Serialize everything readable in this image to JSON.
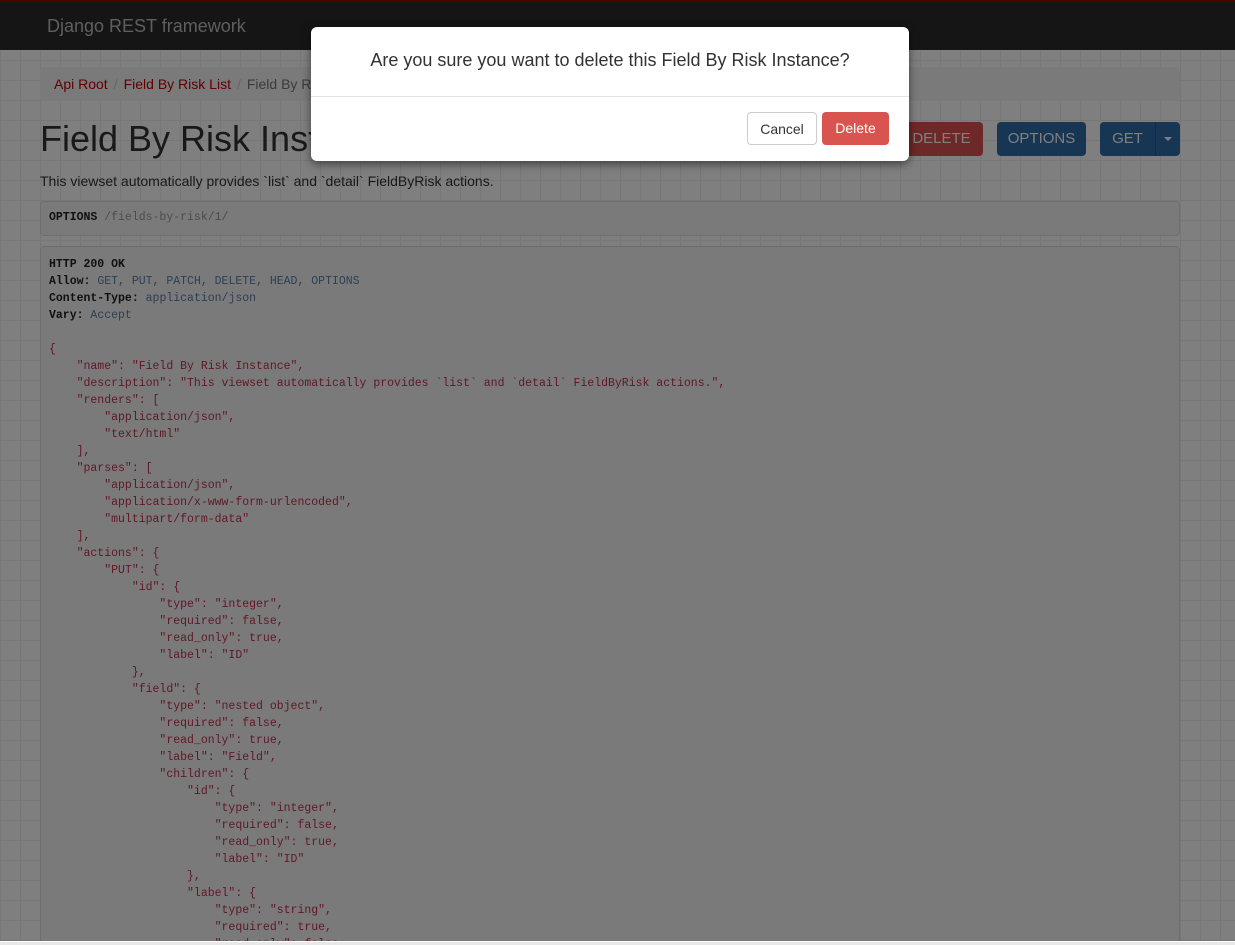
{
  "navbar": {
    "brand": "Django REST framework"
  },
  "breadcrumb": [
    {
      "label": "Api Root"
    },
    {
      "label": "Field By Risk List"
    },
    {
      "label": "Field By Risk Instance"
    }
  ],
  "page": {
    "title": "Field By Risk Instance",
    "description": "This viewset automatically provides `list` and `detail` FieldByRisk actions.",
    "buttons": {
      "delete": "DELETE",
      "options": "OPTIONS",
      "get": "GET"
    }
  },
  "request": {
    "method": "OPTIONS",
    "url": "/fields-by-risk/1/"
  },
  "response": {
    "status": "HTTP 200 OK",
    "headers": [
      {
        "name": "Allow",
        "value": "GET, PUT, PATCH, DELETE, HEAD, OPTIONS"
      },
      {
        "name": "Content-Type",
        "value": "application/json"
      },
      {
        "name": "Vary",
        "value": "Accept"
      }
    ],
    "body_lines": [
      "{",
      "    \"name\": \"Field By Risk Instance\",",
      "    \"description\": \"This viewset automatically provides `list` and `detail` FieldByRisk actions.\",",
      "    \"renders\": [",
      "        \"application/json\",",
      "        \"text/html\"",
      "    ],",
      "    \"parses\": [",
      "        \"application/json\",",
      "        \"application/x-www-form-urlencoded\",",
      "        \"multipart/form-data\"",
      "    ],",
      "    \"actions\": {",
      "        \"PUT\": {",
      "            \"id\": {",
      "                \"type\": \"integer\",",
      "                \"required\": false,",
      "                \"read_only\": true,",
      "                \"label\": \"ID\"",
      "            },",
      "            \"field\": {",
      "                \"type\": \"nested object\",",
      "                \"required\": false,",
      "                \"read_only\": true,",
      "                \"label\": \"Field\",",
      "                \"children\": {",
      "                    \"id\": {",
      "                        \"type\": \"integer\",",
      "                        \"required\": false,",
      "                        \"read_only\": true,",
      "                        \"label\": \"ID\"",
      "                    },",
      "                    \"label\": {",
      "                        \"type\": \"string\",",
      "                        \"required\": true,",
      "                        \"read_only\": false,"
    ]
  },
  "modal": {
    "title": "Are you sure you want to delete this Field By Risk Instance?",
    "cancel": "Cancel",
    "delete": "Delete"
  },
  "colors": {
    "navbar_border": "#a30000",
    "link": "#c20000",
    "danger": "#d9534f",
    "primary": "#2f6da6"
  }
}
